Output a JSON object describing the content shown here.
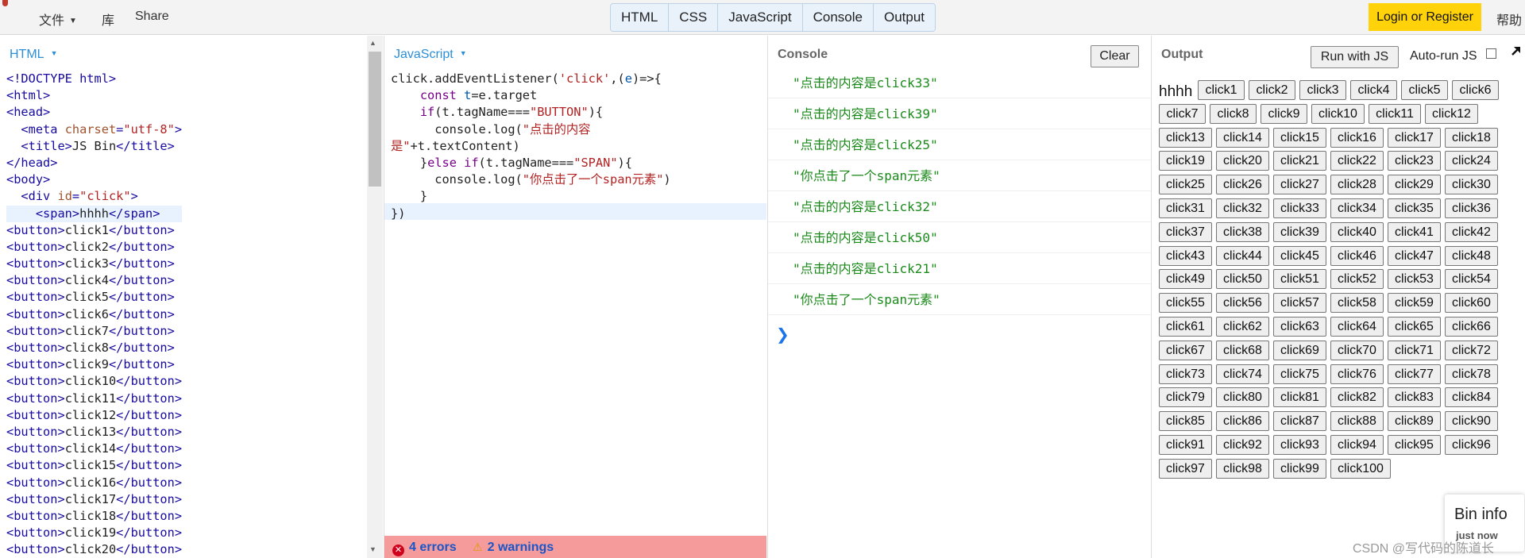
{
  "menu": {
    "file": "文件",
    "library": "库",
    "share": "Share"
  },
  "tabs": [
    "HTML",
    "CSS",
    "JavaScript",
    "Console",
    "Output"
  ],
  "login_label": "Login or Register",
  "help_label": "帮助",
  "html_panel": {
    "label": "HTML",
    "lines": [
      [
        [
          "tag",
          "<!DOCTYPE html>"
        ]
      ],
      [
        [
          "tag",
          "<html>"
        ]
      ],
      [
        [
          "tag",
          "<head>"
        ]
      ],
      [
        [
          "txt",
          "  "
        ],
        [
          "tag",
          "<meta "
        ],
        [
          "attr",
          "charset"
        ],
        [
          "tag",
          "="
        ],
        [
          "str",
          "\"utf-8\""
        ],
        [
          "tag",
          ">"
        ]
      ],
      [
        [
          "txt",
          "  "
        ],
        [
          "tag",
          "<title>"
        ],
        [
          "txt",
          "JS Bin"
        ],
        [
          "tag",
          "</title>"
        ]
      ],
      [
        [
          "tag",
          "</head>"
        ]
      ],
      [
        [
          "tag",
          "<body>"
        ]
      ],
      [
        [
          "txt",
          "  "
        ],
        [
          "tag",
          "<div "
        ],
        [
          "attr",
          "id"
        ],
        [
          "tag",
          "="
        ],
        [
          "str",
          "\"click\""
        ],
        [
          "tag",
          ">"
        ]
      ],
      [
        [
          "txt",
          "    "
        ],
        [
          "tag",
          "<span>"
        ],
        [
          "txt",
          "hhhh"
        ],
        [
          "tag",
          "</span>"
        ]
      ],
      [
        [
          "tag",
          "<button>"
        ],
        [
          "txt",
          "click1"
        ],
        [
          "tag",
          "</button>"
        ]
      ],
      [
        [
          "tag",
          "<button>"
        ],
        [
          "txt",
          "click2"
        ],
        [
          "tag",
          "</button>"
        ]
      ],
      [
        [
          "tag",
          "<button>"
        ],
        [
          "txt",
          "click3"
        ],
        [
          "tag",
          "</button>"
        ]
      ],
      [
        [
          "tag",
          "<button>"
        ],
        [
          "txt",
          "click4"
        ],
        [
          "tag",
          "</button>"
        ]
      ],
      [
        [
          "tag",
          "<button>"
        ],
        [
          "txt",
          "click5"
        ],
        [
          "tag",
          "</button>"
        ]
      ],
      [
        [
          "tag",
          "<button>"
        ],
        [
          "txt",
          "click6"
        ],
        [
          "tag",
          "</button>"
        ]
      ],
      [
        [
          "tag",
          "<button>"
        ],
        [
          "txt",
          "click7"
        ],
        [
          "tag",
          "</button>"
        ]
      ],
      [
        [
          "tag",
          "<button>"
        ],
        [
          "txt",
          "click8"
        ],
        [
          "tag",
          "</button>"
        ]
      ],
      [
        [
          "tag",
          "<button>"
        ],
        [
          "txt",
          "click9"
        ],
        [
          "tag",
          "</button>"
        ]
      ],
      [
        [
          "tag",
          "<button>"
        ],
        [
          "txt",
          "click10"
        ],
        [
          "tag",
          "</button>"
        ]
      ],
      [
        [
          "tag",
          "<button>"
        ],
        [
          "txt",
          "click11"
        ],
        [
          "tag",
          "</button>"
        ]
      ],
      [
        [
          "tag",
          "<button>"
        ],
        [
          "txt",
          "click12"
        ],
        [
          "tag",
          "</button>"
        ]
      ],
      [
        [
          "tag",
          "<button>"
        ],
        [
          "txt",
          "click13"
        ],
        [
          "tag",
          "</button>"
        ]
      ],
      [
        [
          "tag",
          "<button>"
        ],
        [
          "txt",
          "click14"
        ],
        [
          "tag",
          "</button>"
        ]
      ],
      [
        [
          "tag",
          "<button>"
        ],
        [
          "txt",
          "click15"
        ],
        [
          "tag",
          "</button>"
        ]
      ],
      [
        [
          "tag",
          "<button>"
        ],
        [
          "txt",
          "click16"
        ],
        [
          "tag",
          "</button>"
        ]
      ],
      [
        [
          "tag",
          "<button>"
        ],
        [
          "txt",
          "click17"
        ],
        [
          "tag",
          "</button>"
        ]
      ],
      [
        [
          "tag",
          "<button>"
        ],
        [
          "txt",
          "click18"
        ],
        [
          "tag",
          "</button>"
        ]
      ],
      [
        [
          "tag",
          "<button>"
        ],
        [
          "txt",
          "click19"
        ],
        [
          "tag",
          "</button>"
        ]
      ],
      [
        [
          "tag",
          "<button>"
        ],
        [
          "txt",
          "click20"
        ],
        [
          "tag",
          "</button>"
        ]
      ]
    ]
  },
  "js_panel": {
    "label": "JavaScript",
    "lines": [
      [
        [
          "pn",
          "click.addEventListener("
        ],
        [
          "str",
          "'click'"
        ],
        [
          "pn",
          ",("
        ],
        [
          "var",
          "e"
        ],
        [
          "pn",
          ")=>{"
        ]
      ],
      [
        [
          "pn",
          "    "
        ],
        [
          "kw",
          "const "
        ],
        [
          "var",
          "t"
        ],
        [
          "pn",
          "=e.target"
        ]
      ],
      [
        [
          "pn",
          "    "
        ],
        [
          "kw",
          "if"
        ],
        [
          "pn",
          "(t.tagName==="
        ],
        [
          "str",
          "\"BUTTON\""
        ],
        [
          "pn",
          "){"
        ]
      ],
      [
        [
          "pn",
          "      console.log("
        ],
        [
          "str",
          "\"点击的内容"
        ]
      ],
      [
        [
          "str",
          "是\""
        ],
        [
          "pn",
          "+t.textContent)"
        ]
      ],
      [
        [
          "pn",
          "    }"
        ],
        [
          "kw",
          "else if"
        ],
        [
          "pn",
          "(t.tagName==="
        ],
        [
          "str",
          "\"SPAN\""
        ],
        [
          "pn",
          "){"
        ]
      ],
      [
        [
          "pn",
          "      console.log("
        ],
        [
          "str",
          "\"你点击了一个span元素\""
        ],
        [
          "pn",
          ")"
        ]
      ],
      [
        [
          "pn",
          "    }"
        ]
      ],
      [
        [
          "pn",
          "})"
        ]
      ]
    ],
    "errors": "4 errors",
    "warnings": "2 warnings"
  },
  "console_panel": {
    "title": "Console",
    "clear_label": "Clear",
    "entries": [
      "\"点击的内容是click33\"",
      "\"点击的内容是click39\"",
      "\"点击的内容是click25\"",
      "\"你点击了一个span元素\"",
      "\"点击的内容是click32\"",
      "\"点击的内容是click50\"",
      "\"点击的内容是click21\"",
      "\"你点击了一个span元素\""
    ],
    "prompt": "❯"
  },
  "output_panel": {
    "title": "Output",
    "run_label": "Run with JS",
    "autorun_label": "Auto-run JS",
    "span_text": "hhhh",
    "button_prefix": "click",
    "button_count": 100,
    "bin_info_title": "Bin info",
    "bin_info_time": "just now"
  },
  "watermark": "CSDN @写代码的陈道长",
  "icons": {
    "menu_caret": "caret-down-icon",
    "error": "error-circle-icon",
    "warning": "warning-triangle-icon",
    "popout": "popout-arrow-icon",
    "console_prompt": "chevron-right-icon"
  },
  "colors": {
    "accent_blue": "#2b8fd8",
    "login_yellow": "#ffd20a",
    "error_bar": "#f59b9b",
    "console_green": "#1a8a1a"
  }
}
